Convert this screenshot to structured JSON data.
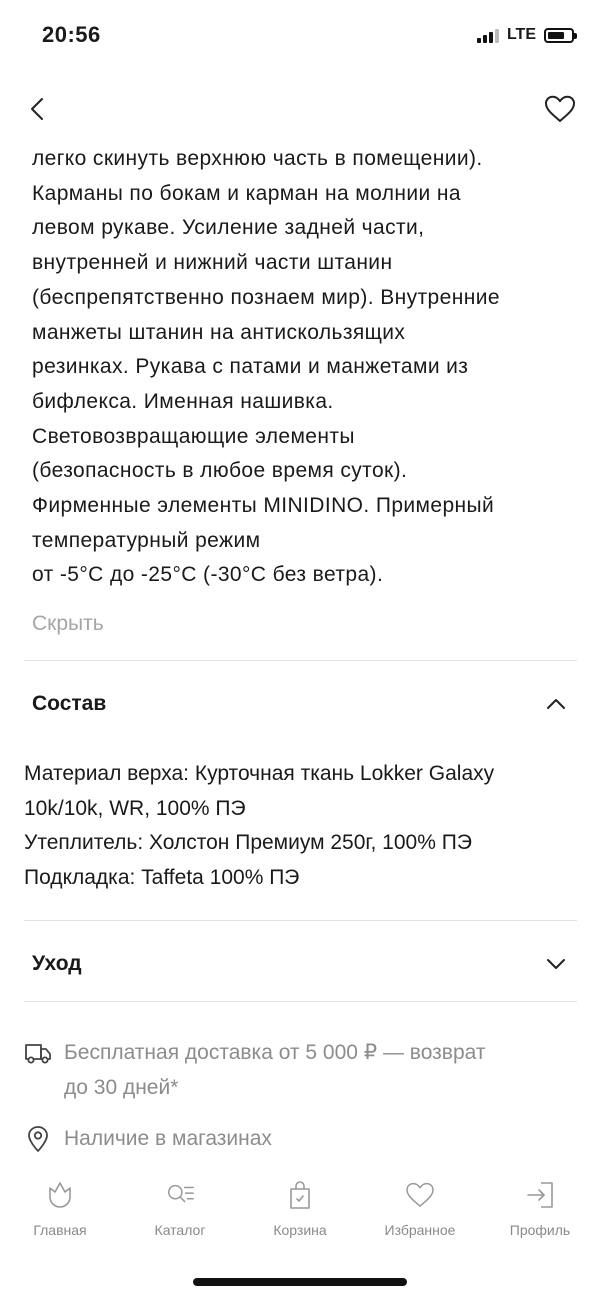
{
  "status_bar": {
    "time": "20:56",
    "network": "LTE"
  },
  "description": {
    "lines": [
      "легко скинуть верхнюю часть в помещении).",
      "Карманы по бокам и карман на молнии на",
      "левом рукаве. Усиление задней части,",
      "внутренней и нижний части штанин",
      "(беспрепятственно познаем мир). Внутренние",
      "манжеты штанин на антискользящих",
      "резинках. Рукава с патами и манжетами из",
      "бифлекса. Именная нашивка.",
      "Световозвращающие элементы",
      "(безопасность в любое время суток).",
      "Фирменные элементы MINIDINO. Примерный",
      "температурный режим",
      "от -5°C до -25°C (-30°C без ветра)."
    ],
    "hide_label": "Скрыть"
  },
  "composition": {
    "title": "Состав",
    "lines": [
      "Материал верха: Курточная ткань Lokker Galaxy",
      "10k/10k, WR, 100% ПЭ",
      "Утеплитель: Холстон Премиум 250г, 100% ПЭ",
      "Подкладка: Taffeta 100% ПЭ"
    ]
  },
  "care": {
    "title": "Уход"
  },
  "delivery": {
    "icon": "truck-icon",
    "line1": "Бесплатная доставка от 5 000 ₽ — возврат",
    "line2": "до 30 дней*"
  },
  "stores": {
    "icon": "location-pin-icon",
    "text": "Наличие в магазинах"
  },
  "tabs": [
    {
      "label": "Главная",
      "icon": "tulip-icon"
    },
    {
      "label": "Каталог",
      "icon": "catalog-search-icon"
    },
    {
      "label": "Корзина",
      "icon": "bag-icon"
    },
    {
      "label": "Избранное",
      "icon": "heart-icon"
    },
    {
      "label": "Профиль",
      "icon": "login-icon"
    }
  ],
  "colors": {
    "text": "#1a1a1a",
    "muted": "#8c8c8c",
    "link_muted": "#a6a6a6",
    "divider": "#e2e2e2",
    "tab_label": "#8a8a8a"
  }
}
